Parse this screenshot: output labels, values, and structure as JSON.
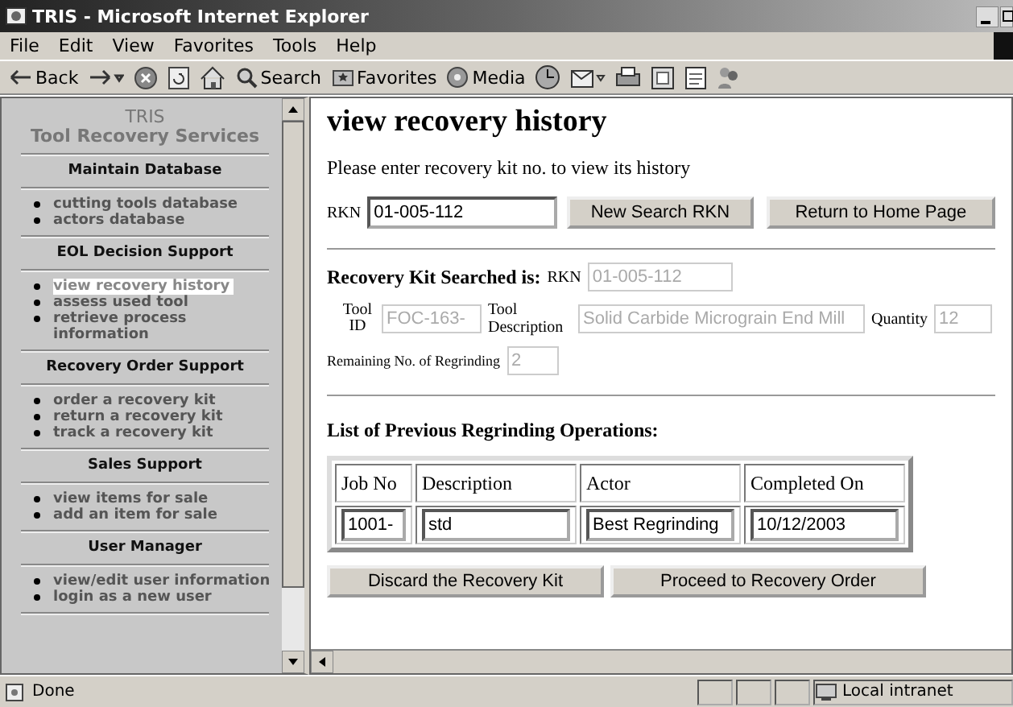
{
  "window": {
    "title": "TRIS - Microsoft Internet Explorer"
  },
  "menu": [
    "File",
    "Edit",
    "View",
    "Favorites",
    "Tools",
    "Help"
  ],
  "toolbar": [
    {
      "kind": "back",
      "label": "Back"
    },
    {
      "kind": "forward"
    },
    {
      "kind": "stop"
    },
    {
      "kind": "refresh"
    },
    {
      "kind": "home"
    },
    {
      "kind": "search",
      "label": "Search"
    },
    {
      "kind": "favorites",
      "label": "Favorites"
    },
    {
      "kind": "media",
      "label": "Media"
    },
    {
      "kind": "history"
    },
    {
      "kind": "mail"
    },
    {
      "kind": "print"
    },
    {
      "kind": "edit"
    },
    {
      "kind": "discuss"
    },
    {
      "kind": "messenger"
    }
  ],
  "sidebar": {
    "title": "TRIS",
    "subtitle": "Tool Recovery Services",
    "sections": [
      {
        "heading": "Maintain Database",
        "items": [
          {
            "label": "cutting tools database",
            "selected": false
          },
          {
            "label": "actors database",
            "selected": false
          }
        ]
      },
      {
        "heading": "EOL Decision Support",
        "items": [
          {
            "label": "view recovery history",
            "selected": true
          },
          {
            "label": "assess used tool",
            "selected": false
          },
          {
            "label": "retrieve process information",
            "selected": false
          }
        ]
      },
      {
        "heading": "Recovery Order Support",
        "items": [
          {
            "label": "order a recovery kit",
            "selected": false
          },
          {
            "label": "return a recovery kit",
            "selected": false
          },
          {
            "label": "track a recovery kit",
            "selected": false
          }
        ]
      },
      {
        "heading": "Sales Support",
        "items": [
          {
            "label": "view items for sale",
            "selected": false
          },
          {
            "label": "add an item for sale",
            "selected": false
          }
        ]
      },
      {
        "heading": "User Manager",
        "items": [
          {
            "label": "view/edit user information",
            "selected": false
          },
          {
            "label": "login as a new user",
            "selected": false
          }
        ]
      }
    ]
  },
  "main": {
    "heading": "view recovery history",
    "prompt": "Please enter recovery kit no. to view its history",
    "search": {
      "label": "RKN",
      "value": "01-005-112",
      "disabled": false
    },
    "buttons": [
      "New Search RKN",
      "Return to Home Page"
    ],
    "result": {
      "heading": "Recovery Kit Searched is:",
      "rkn": {
        "label": "RKN",
        "value": "01-005-112",
        "disabled": true
      },
      "tool_id": {
        "label": "Tool ID",
        "value": "FOC-163-",
        "disabled": true
      },
      "tool_description": {
        "label": "Tool Description",
        "value": "Solid Carbide Micrograin End Mill",
        "disabled": true
      },
      "quantity": {
        "label": "Quantity",
        "value": "12",
        "disabled": true
      },
      "remaining": {
        "label": "Remaining No. of Regrinding",
        "value": "2",
        "disabled": true
      }
    },
    "list_heading": "List of Previous Regrinding Operations:",
    "table": {
      "columns": [
        "Job No",
        "Description",
        "Actor",
        "Completed On"
      ],
      "rows": [
        [
          "1001-",
          "std",
          "Best Regrinding",
          "10/12/2003"
        ]
      ]
    },
    "actions": [
      "Discard the Recovery Kit",
      "Proceed to Recovery Order"
    ]
  },
  "status_bar": {
    "text": "Done",
    "zone": "Local intranet"
  }
}
